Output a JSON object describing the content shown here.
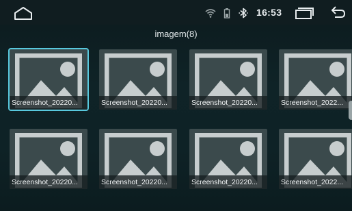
{
  "status_bar": {
    "time": "16:53",
    "icons": [
      "home-icon",
      "wifi-icon",
      "battery-icon",
      "bluetooth-icon",
      "recents-icon",
      "back-icon"
    ]
  },
  "folder": {
    "title": "imagem(8)"
  },
  "images": [
    {
      "name": "Screenshot_20220..."
    },
    {
      "name": "Screenshot_20220..."
    },
    {
      "name": "Screenshot_20220..."
    },
    {
      "name": "Screenshot_2022..."
    },
    {
      "name": "Screenshot_20220..."
    },
    {
      "name": "Screenshot_20220..."
    },
    {
      "name": "Screenshot_20220..."
    },
    {
      "name": "Screenshot_2022..."
    }
  ],
  "colors": {
    "selection": "#58c9de",
    "background": "#0f2327",
    "tile": "#3b4a4c",
    "placeholder_fill": "#c7cdce"
  }
}
